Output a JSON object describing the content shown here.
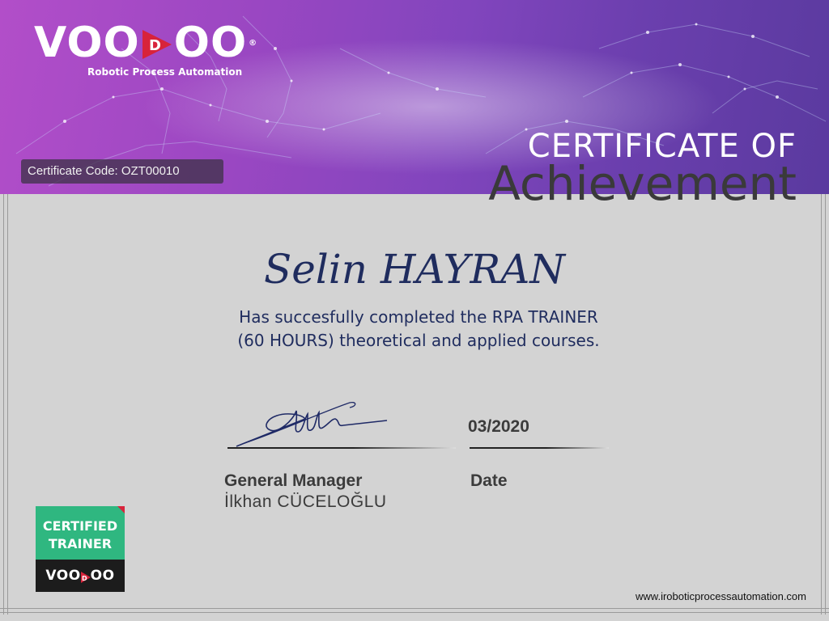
{
  "brand": {
    "logo_left": "VOO",
    "logo_mid": "D",
    "logo_right": "OO",
    "registered": "®",
    "tagline": "Robotic Process Automation",
    "accent_red": "#d8233b"
  },
  "certificate": {
    "code_label": "Certificate Code:",
    "code_value": "OZT00010",
    "title_line1": "CERTIFICATE OF",
    "title_line2": "Achievement",
    "recipient": "Selin HAYRAN",
    "description_line1": "Has succesfully completed the RPA TRAINER",
    "description_line2": "(60 HOURS) theoretical and applied courses.",
    "date_value": "03/2020",
    "signer_role": "General Manager",
    "signer_name": "İlkhan CÜCELOĞLU",
    "date_label": "Date"
  },
  "badge": {
    "line1": "CERTIFIED",
    "line2": "TRAINER",
    "logo_left": "VOO",
    "logo_mid": "D",
    "logo_right": "OO",
    "green": "#2fb780"
  },
  "footer": {
    "website": "www.iroboticprocessautomation.com"
  }
}
